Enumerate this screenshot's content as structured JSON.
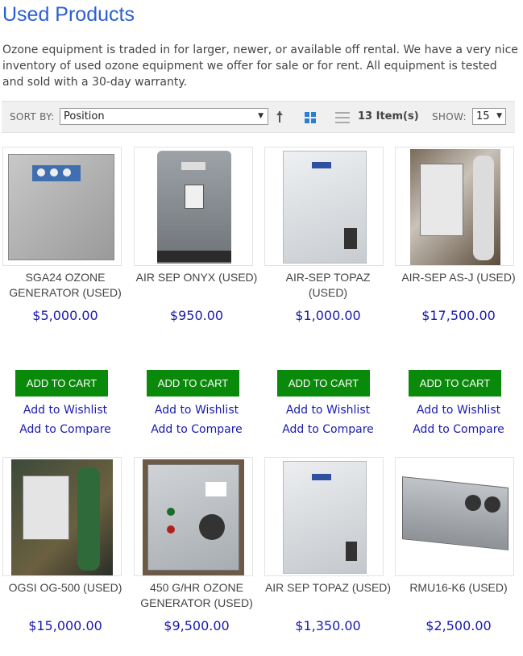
{
  "page": {
    "title": "Used Products",
    "intro": "Ozone equipment is traded in for larger, newer, or available off rental. We have a very nice inventory of used ozone equipment we offer for sale or for rent. All equipment is tested and sold with a 30-day warranty."
  },
  "toolbar": {
    "sort_label": "SORT BY:",
    "sort_value": "Position",
    "item_count": "13 Item(s)",
    "show_label": "SHOW:",
    "show_value": "15"
  },
  "products": [
    {
      "name_line1": "SGA24 OZONE",
      "name_line2": "GENERATOR (USED)",
      "price": "$5,000.00",
      "cart": "ADD TO CART",
      "wishlist": "Add to Wishlist",
      "compare": "Add to Compare"
    },
    {
      "name_line1": "AIR SEP ONYX (USED)",
      "name_line2": "",
      "price": "$950.00",
      "cart": "ADD TO CART",
      "wishlist": "Add to Wishlist",
      "compare": "Add to Compare"
    },
    {
      "name_line1": "AIR-SEP TOPAZ",
      "name_line2": "(USED)",
      "price": "$1,000.00",
      "cart": "ADD TO CART",
      "wishlist": "Add to Wishlist",
      "compare": "Add to Compare"
    },
    {
      "name_line1": "AIR-SEP AS-J (USED)",
      "name_line2": "",
      "price": "$17,500.00",
      "cart": "ADD TO CART",
      "wishlist": "Add to Wishlist",
      "compare": "Add to Compare"
    },
    {
      "name_line1": "OGSI OG-500 (USED)",
      "name_line2": "",
      "price": "$15,000.00"
    },
    {
      "name_line1": "450 G/HR OZONE",
      "name_line2": "GENERATOR (USED)",
      "price": "$9,500.00"
    },
    {
      "name_line1": "AIR SEP TOPAZ (USED)",
      "name_line2": "",
      "price": "$1,350.00"
    },
    {
      "name_line1": "RMU16-K6 (USED)",
      "name_line2": "",
      "price": "$2,500.00"
    }
  ],
  "colors": {
    "title": "#2a5fd1",
    "price": "#1a1ab0",
    "cart_button": "#0a8a0a",
    "grid_icon_active": "#2a7fd4"
  }
}
